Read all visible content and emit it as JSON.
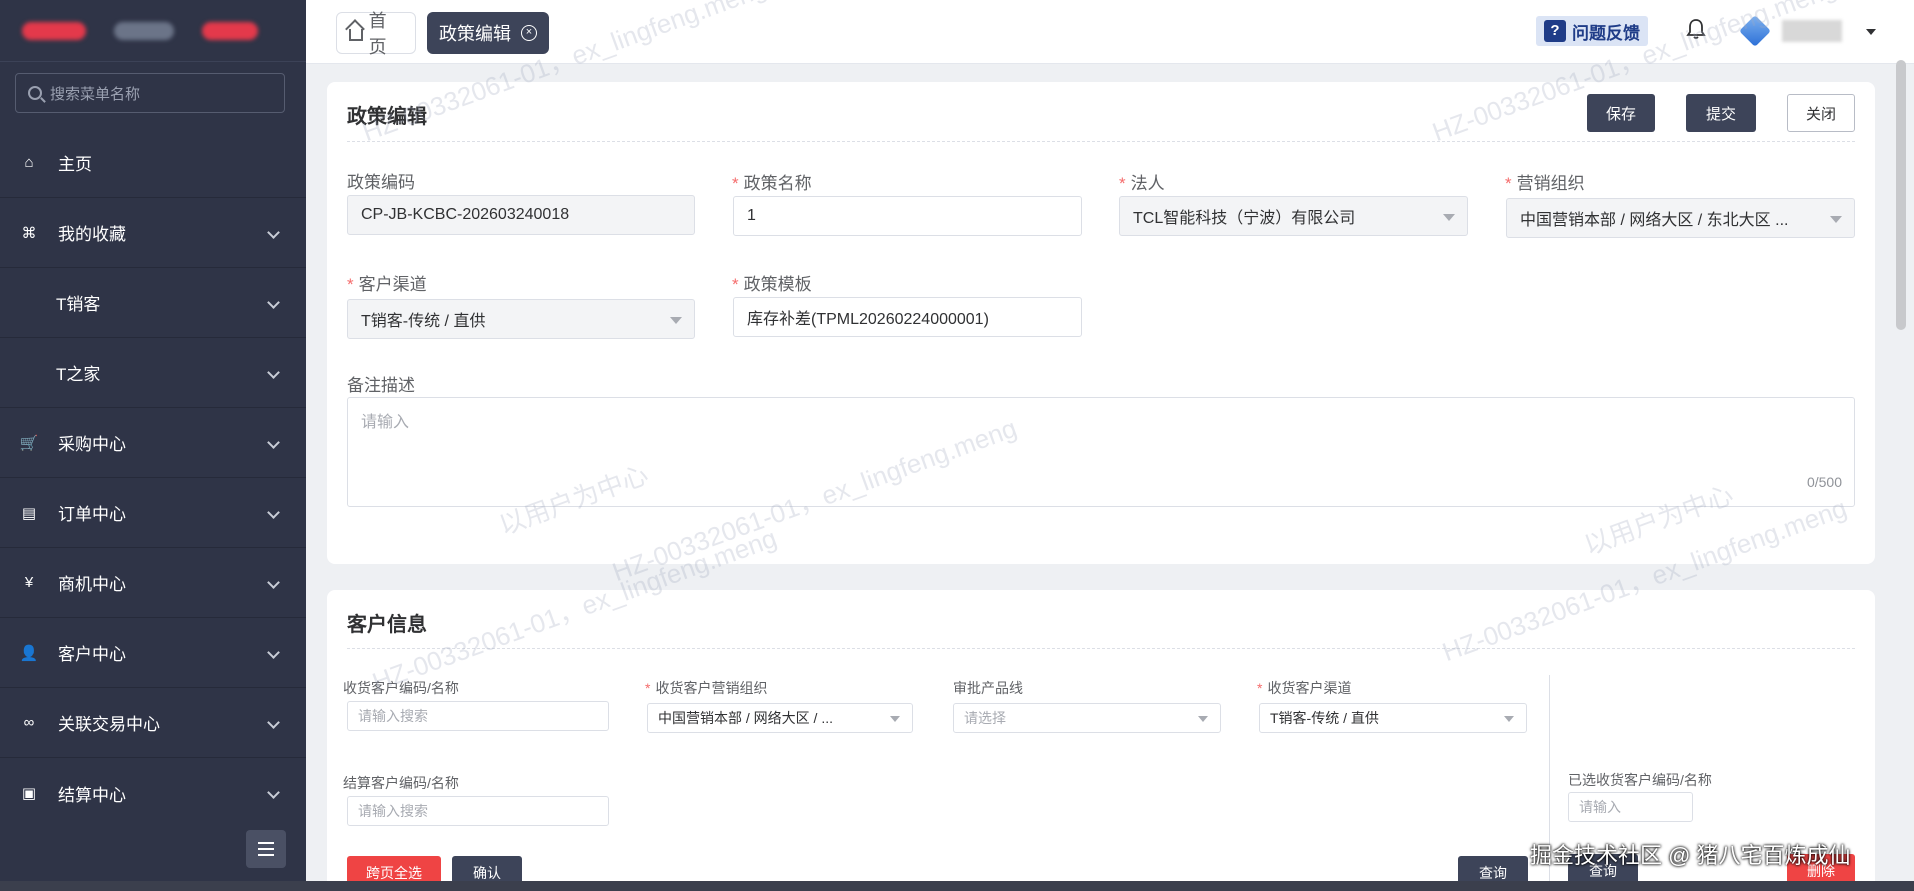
{
  "sidebar": {
    "search_placeholder": "搜索菜单名称",
    "items": [
      {
        "label": "主页",
        "icon": "home-icon",
        "glyph": "⌂"
      },
      {
        "label": "我的收藏",
        "icon": "favorites-icon",
        "glyph": "⌘"
      },
      {
        "label": "T销客",
        "icon": "",
        "glyph": ""
      },
      {
        "label": "T之家",
        "icon": "",
        "glyph": ""
      },
      {
        "label": "采购中心",
        "icon": "cart-icon",
        "glyph": "🛒"
      },
      {
        "label": "订单中心",
        "icon": "order-icon",
        "glyph": "▤"
      },
      {
        "label": "商机中心",
        "icon": "yen-icon",
        "glyph": "¥"
      },
      {
        "label": "客户中心",
        "icon": "user-icon",
        "glyph": "👤"
      },
      {
        "label": "关联交易中心",
        "icon": "link-icon",
        "glyph": "∞"
      },
      {
        "label": "结算中心",
        "icon": "settle-icon",
        "glyph": "▣"
      }
    ]
  },
  "tabs": {
    "home": "首页",
    "active": "政策编辑"
  },
  "header": {
    "feedback": "问题反馈",
    "feedback_glyph": "?"
  },
  "policy": {
    "title": "政策编辑",
    "buttons": {
      "save": "保存",
      "submit": "提交",
      "close": "关闭"
    },
    "fields": {
      "code_label": "政策编码",
      "code_value": "CP-JB-KCBC-202603240018",
      "name_label": "政策名称",
      "name_value": "1",
      "legal_label": "法人",
      "legal_value": "TCL智能科技（宁波）有限公司",
      "org_label": "营销组织",
      "org_value": "中国营销本部 / 网络大区 / 东北大区 ...",
      "channel_label": "客户渠道",
      "channel_value": "T销客-传统 / 直供",
      "template_label": "政策模板",
      "template_value": "库存补差(TPML20260224000001)",
      "remark_label": "备注描述",
      "remark_placeholder": "请输入",
      "remark_counter": "0/500"
    }
  },
  "customer": {
    "title": "客户信息",
    "receiver_code_label": "收货客户编码/名称",
    "receiver_code_placeholder": "请输入搜索",
    "receiver_org_label": "收货客户营销组织",
    "receiver_org_value": "中国营销本部 / 网络大区 / ...",
    "product_line_label": "审批产品线",
    "product_line_placeholder": "请选择",
    "receiver_channel_label": "收货客户渠道",
    "receiver_channel_value": "T销客-传统 / 直供",
    "settle_code_label": "结算客户编码/名称",
    "settle_code_placeholder": "请输入搜索",
    "selected_label": "已选收货客户编码/名称",
    "selected_placeholder": "请输入",
    "buttons": {
      "select_all": "跨页全选",
      "confirm": "确认",
      "query": "查询",
      "query2": "查询",
      "delete": "删除"
    }
  },
  "watermark": {
    "line1": "HZ-00332061-01，ex_lingfeng.meng",
    "line2": "以用户为中心"
  },
  "footer": {
    "source": "掘金技术社区 @ 猪八宅百炼成仙"
  },
  "colors": {
    "sidebar_bg": "#2f3447",
    "primary_dark": "#3d4459",
    "required": "#f56c6c",
    "danger": "#ef4444",
    "feedback_bg": "#dbe4f5"
  }
}
